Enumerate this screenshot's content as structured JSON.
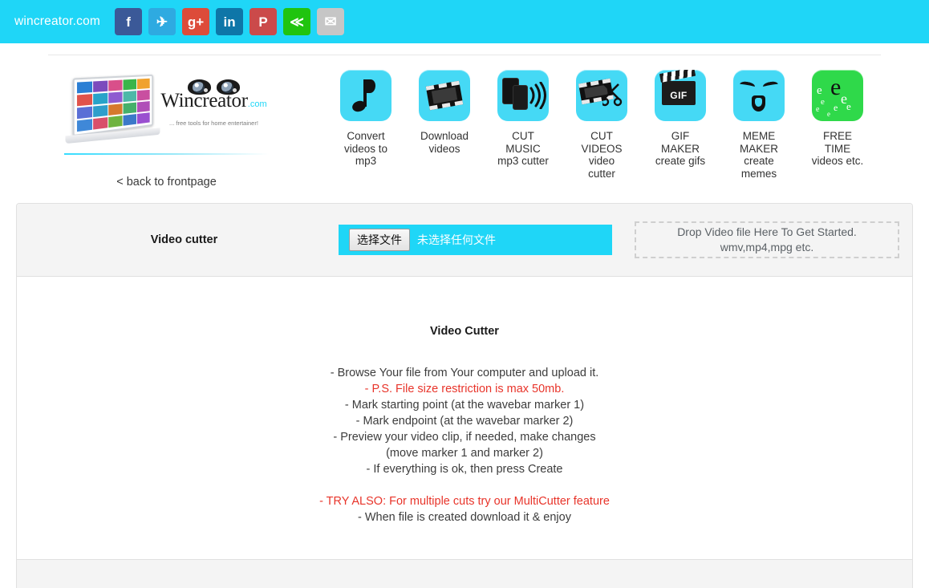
{
  "header": {
    "brand": "wincreator.com",
    "social": [
      {
        "name": "facebook-share-button",
        "glyph": "f",
        "color": "#3b5998"
      },
      {
        "name": "twitter-share-button",
        "glyph": "✈",
        "color": "#2eaae1"
      },
      {
        "name": "googleplus-share-button",
        "glyph": "g+",
        "color": "#dd4b39"
      },
      {
        "name": "linkedin-share-button",
        "glyph": "in",
        "color": "#0e76a8"
      },
      {
        "name": "pinterest-share-button",
        "glyph": "P",
        "color": "#cb4a4a"
      },
      {
        "name": "share-button",
        "glyph": "≪",
        "color": "#20c40f"
      },
      {
        "name": "email-share-button",
        "glyph": "✉",
        "color": "#c6c6c6"
      }
    ]
  },
  "logo": {
    "word": "Wincreator",
    "dotcom": ".com",
    "tagline": "... free tools for home entertainer!",
    "back_link": "< back to frontpage"
  },
  "tools": [
    {
      "icon": "music-note-icon",
      "label": "Convert\nvideos to\nmp3",
      "green": false
    },
    {
      "icon": "film-strip-icon",
      "label": "Download\nvideos",
      "green": false
    },
    {
      "icon": "phones-sound-icon",
      "label": "CUT\nMUSIC\nmp3 cutter",
      "green": false
    },
    {
      "icon": "film-scissors-icon",
      "label": "CUT\nVIDEOS\nvideo\ncutter",
      "green": false
    },
    {
      "icon": "gif-clapper-icon",
      "label": "GIF\nMAKER\ncreate gifs",
      "green": false
    },
    {
      "icon": "meme-face-icon",
      "label": "MEME\nMAKER\ncreate\nmemes",
      "green": false
    },
    {
      "icon": "e-cloud-icon",
      "label": "FREE\nTIME\nvideos etc.",
      "green": true
    }
  ],
  "panel": {
    "title": "Video cutter",
    "file_button_label": "选择文件",
    "file_name": "未选择任何文件",
    "dropzone_line1": "Drop Video file Here To Get Started.",
    "dropzone_line2": "wmv,mp4,mpg etc.",
    "body_title": "Video Cutter",
    "instructions": [
      {
        "text": "- Browse Your file from Your computer and upload it.",
        "red": false
      },
      {
        "text": "- P.S. File size restriction is max 50mb.",
        "red": true
      },
      {
        "text": "- Mark starting point (at the wavebar marker 1)",
        "red": false
      },
      {
        "text": "- Mark endpoint (at the wavebar marker 2)",
        "red": false
      },
      {
        "text": "- Preview your video clip, if needed, make changes",
        "red": false
      },
      {
        "text": "(move marker 1 and marker 2)",
        "red": false
      },
      {
        "text": "- If everything is ok, then press Create",
        "red": false
      },
      {
        "text": "",
        "red": false
      },
      {
        "text": "- TRY ALSO: For multiple cuts try our MultiCutter feature",
        "red": true
      },
      {
        "text": "- When file is created download it & enjoy",
        "red": false
      }
    ]
  },
  "colors": {
    "accent_cyan": "#1fd6f7",
    "tile_cyan": "#45d9f5",
    "tile_green": "#2fd94a",
    "alert_red": "#e8342a"
  }
}
